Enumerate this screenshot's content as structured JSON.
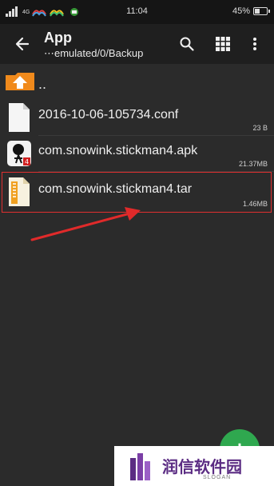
{
  "status_bar": {
    "time": "11:04",
    "battery_text": "45%",
    "battery_level": 0.45,
    "signal_label": "4G"
  },
  "toolbar": {
    "title": "App",
    "path": "⋯emulated/0/Backup",
    "icons": [
      "back-arrow-icon",
      "search-icon",
      "grid-view-icon",
      "more-vert-icon"
    ]
  },
  "file_list": {
    "parent_label": "..",
    "items": [
      {
        "name": "2016-10-06-105734.conf",
        "size": "23 B",
        "icon": "document-icon"
      },
      {
        "name": "com.snowink.stickman4.apk",
        "size": "21.37MB",
        "icon": "app-icon"
      },
      {
        "name": "com.snowink.stickman4.tar",
        "size": "1.46MB",
        "icon": "archive-icon",
        "highlighted": true
      }
    ]
  },
  "fab": {
    "label": "+"
  },
  "watermark": {
    "text": "润信软件园",
    "slogan": "SLOGAN"
  },
  "colors": {
    "background": "#2b2b2b",
    "toolbar": "#1f1f1f",
    "status_bar": "#151515",
    "highlight": "#e03030",
    "fab": "#2fa84f",
    "folder": "#f08a1c",
    "watermark_brand": "#5b2c83"
  }
}
